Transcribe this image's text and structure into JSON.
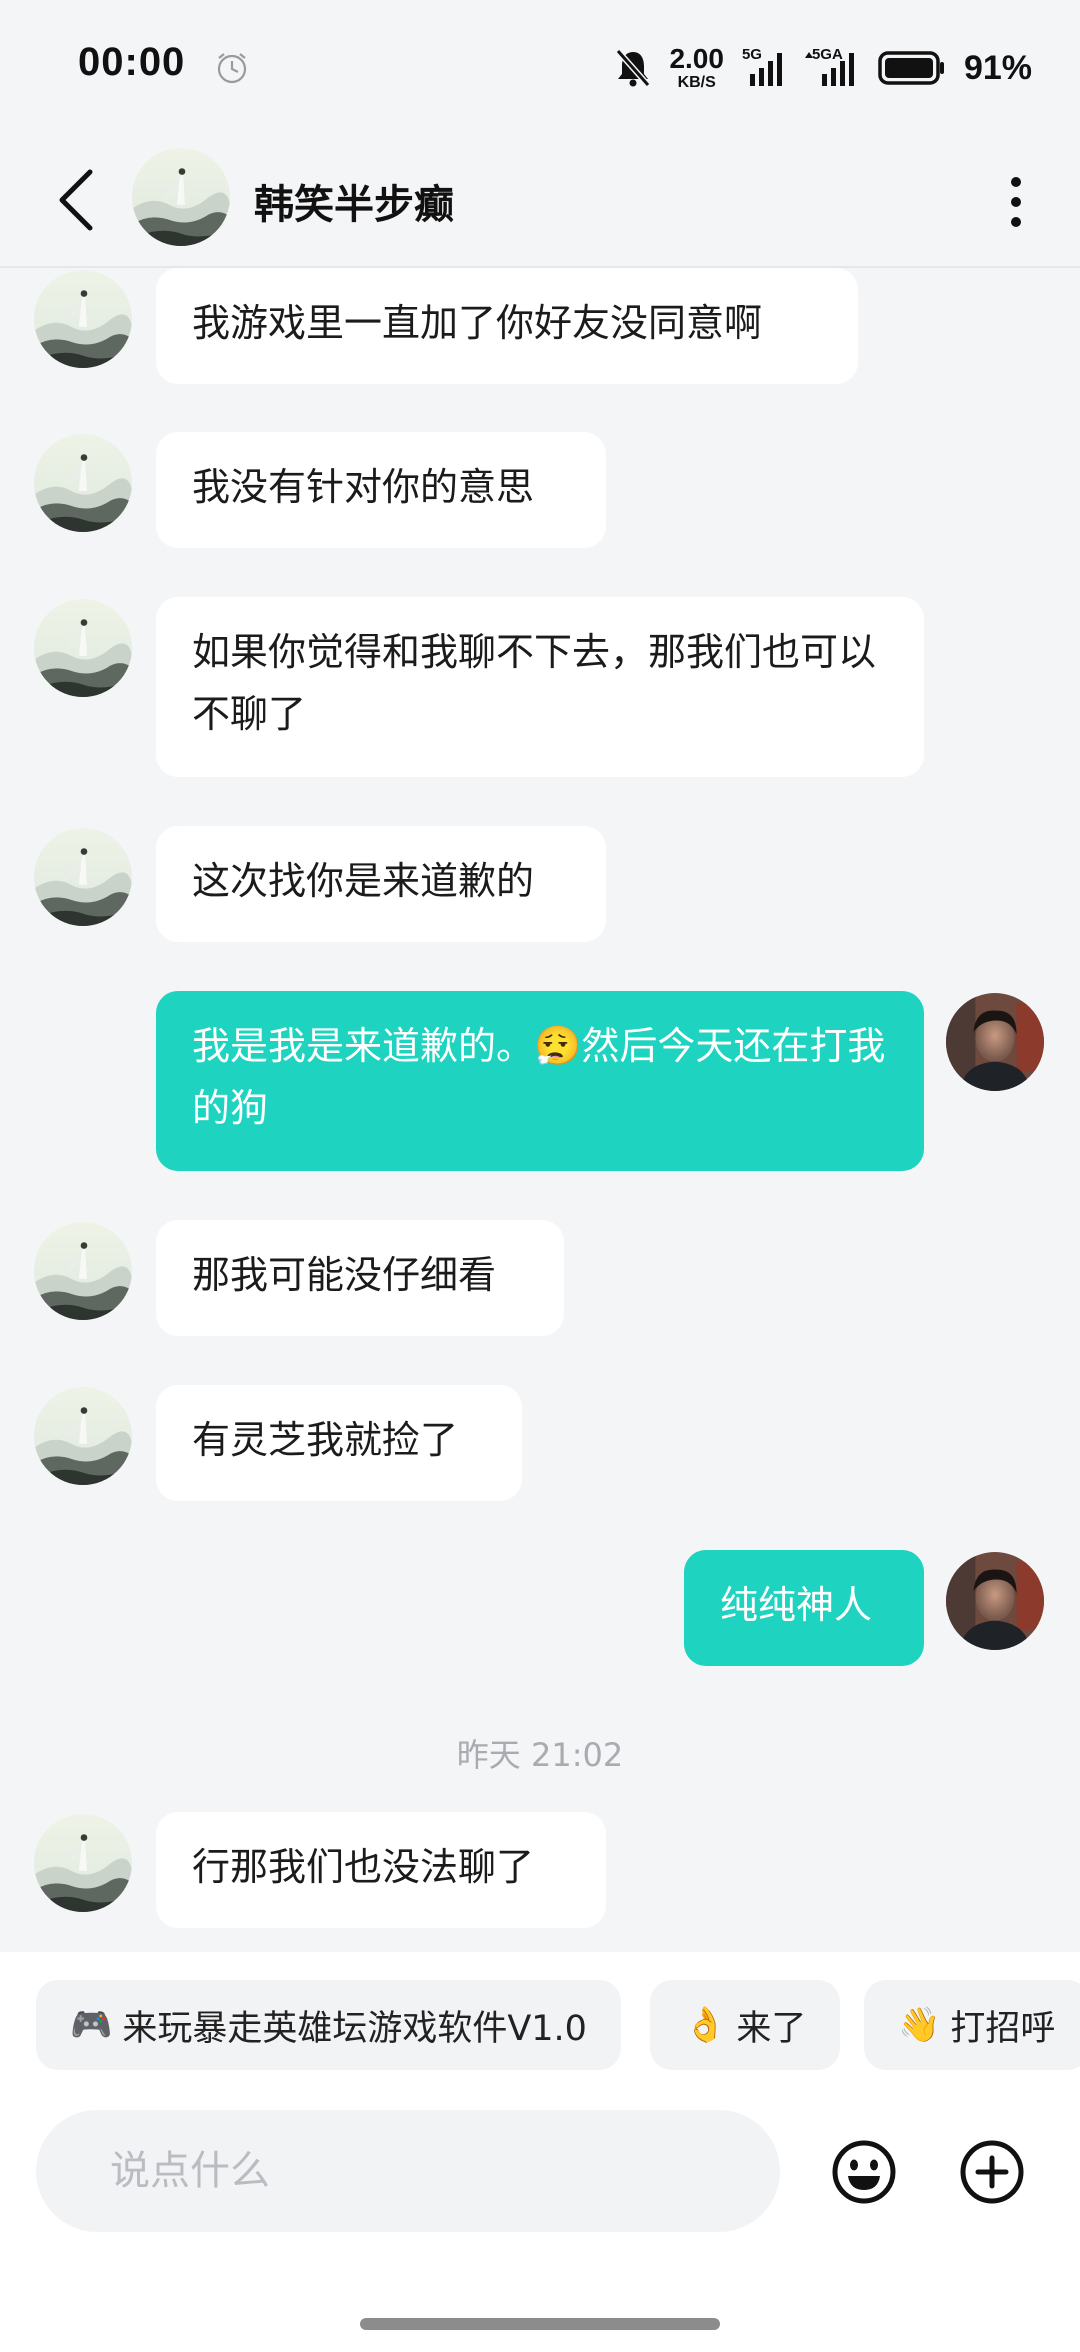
{
  "status_bar": {
    "time": "00:00",
    "net_speed_value": "2.00",
    "net_speed_unit": "KB/S",
    "signal1_label": "5G",
    "signal2_label": "5GA",
    "battery_percent": "91%",
    "icons": [
      "alarm-clock-icon",
      "mute-bell-icon",
      "signal-5g-icon",
      "signal-5ga-icon",
      "battery-icon"
    ]
  },
  "header": {
    "contact_name": "韩笑半步癫",
    "icons": [
      "back-arrow-icon",
      "more-vertical-icon"
    ]
  },
  "messages": [
    {
      "side": "in",
      "text": "我游戏里一直加了你好友没同意啊"
    },
    {
      "side": "in",
      "text": "我没有针对你的意思"
    },
    {
      "side": "in",
      "text": "如果你觉得和我聊不下去，那我们也可以不聊了"
    },
    {
      "side": "in",
      "text": "这次找你是来道歉的"
    },
    {
      "side": "out",
      "text_before_emoji": "我是我是来道歉的。",
      "emoji": "😮‍💨",
      "text_after_emoji": "然后今天还在打我的狗"
    },
    {
      "side": "in",
      "text": "那我可能没仔细看"
    },
    {
      "side": "in",
      "text": "有灵芝我就捡了"
    },
    {
      "side": "out",
      "text": "纯纯神人"
    },
    {
      "type": "timestamp",
      "text": "昨天  21:02"
    },
    {
      "side": "in",
      "text": "行那我们也没法聊了"
    }
  ],
  "quick_replies": [
    {
      "icon": "🎮",
      "label": "来玩暴走英雄坛游戏软件V1.0"
    },
    {
      "icon": "👌",
      "label": "来了"
    },
    {
      "icon": "👋",
      "label": "打招呼"
    }
  ],
  "composer": {
    "placeholder": "说点什么",
    "icons": [
      "emoji-face-icon",
      "plus-circle-icon"
    ]
  },
  "colors": {
    "outgoing_bubble": "#1ed3bf",
    "incoming_bubble": "#ffffff",
    "background": "#f4f5f7"
  }
}
